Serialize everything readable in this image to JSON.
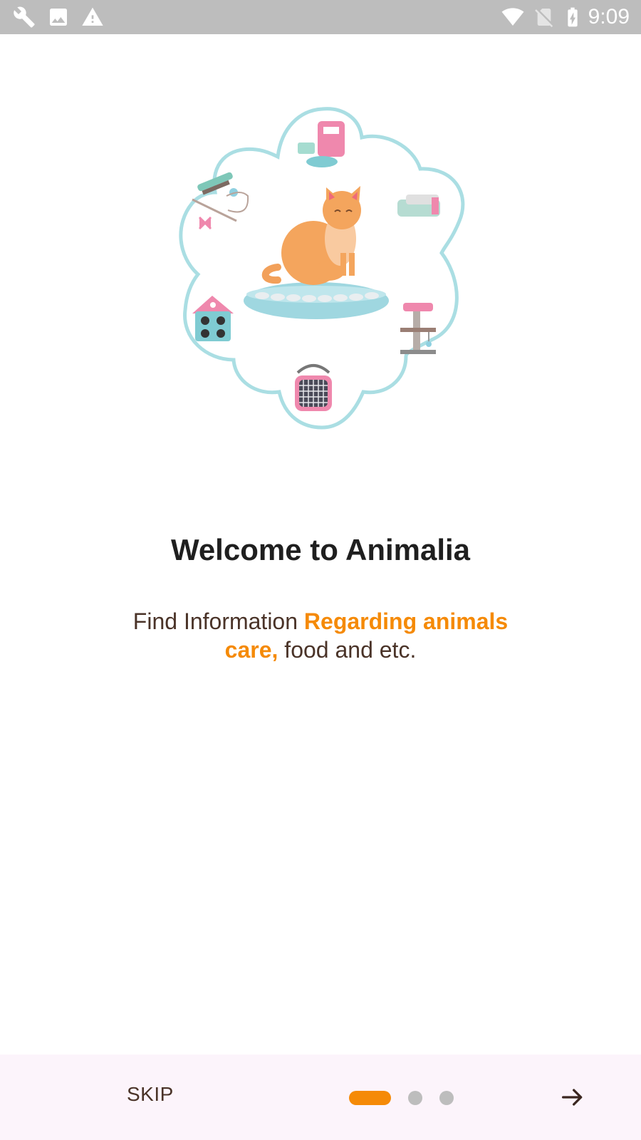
{
  "status_bar": {
    "time": "9:09",
    "icons": [
      "wrench-icon",
      "image-icon",
      "warning-icon",
      "wifi-icon",
      "no-sim-icon",
      "battery-charging-icon"
    ]
  },
  "onboarding": {
    "title": "Welcome to Animalia",
    "subtitle": {
      "part1": "Find Information ",
      "highlight": "Regarding animals care,",
      "part2": " food and etc."
    },
    "highlight_color": "#f58a07"
  },
  "bottom_bar": {
    "skip_label": "SKIP",
    "page_indicator": {
      "active_index": 0,
      "total": 3
    },
    "next_icon": "arrow-right-icon"
  }
}
